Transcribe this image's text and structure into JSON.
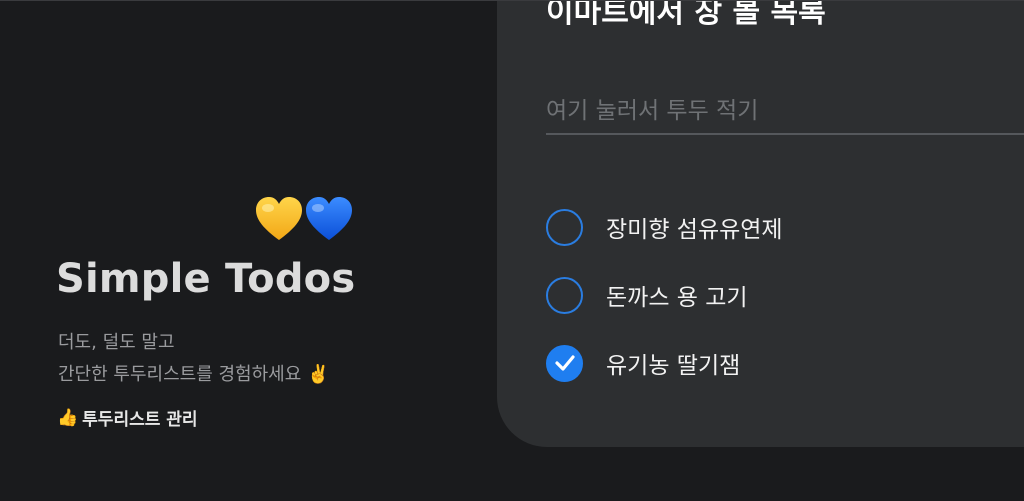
{
  "branding": {
    "hearts": [
      "yellow-heart-icon",
      "blue-heart-icon"
    ],
    "heart_colors": {
      "yellow": "#f7c52b",
      "blue": "#1e6cff"
    },
    "title": "Simple Todos",
    "tagline_line1": "더도, 덜도 말고",
    "tagline_line2": "간단한 투두리스트를 경험하세요 ✌️",
    "feature_icon": "👍",
    "feature_label": "투두리스트 관리"
  },
  "todo_card": {
    "title": "이마트에서 장 볼 목록",
    "input": {
      "value": "",
      "placeholder": "여기 눌러서 투두 적기"
    },
    "items": [
      {
        "label": "장미향 섬유유연제",
        "completed": false
      },
      {
        "label": "돈까스 용 고기",
        "completed": false
      },
      {
        "label": "유기농 딸기잼",
        "completed": true
      }
    ]
  },
  "colors": {
    "background": "#1a1b1d",
    "card": "#2d2f31",
    "accent": "#1f7ef0",
    "title_text": "#dcdcdc",
    "muted_text": "#9a9b9e"
  }
}
